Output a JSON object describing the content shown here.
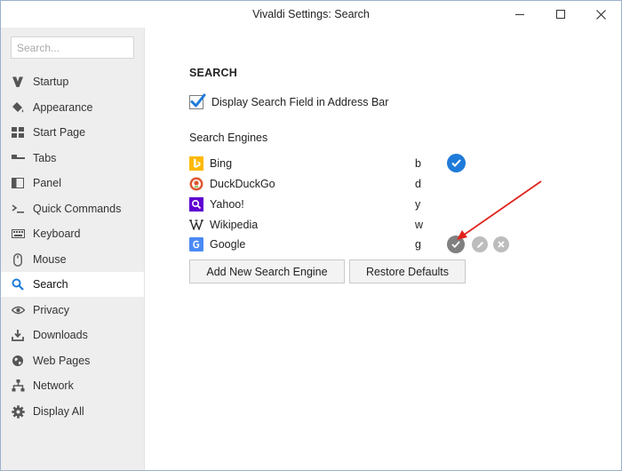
{
  "window": {
    "title": "Vivaldi Settings: Search"
  },
  "sidebar": {
    "search_placeholder": "Search...",
    "items": [
      {
        "label": "Startup",
        "icon": "vivaldi-v-icon",
        "active": false
      },
      {
        "label": "Appearance",
        "icon": "paint-bucket-icon",
        "active": false
      },
      {
        "label": "Start Page",
        "icon": "grid-icon",
        "active": false
      },
      {
        "label": "Tabs",
        "icon": "tabs-icon",
        "active": false
      },
      {
        "label": "Panel",
        "icon": "panel-icon",
        "active": false
      },
      {
        "label": "Quick Commands",
        "icon": "command-prompt-icon",
        "active": false
      },
      {
        "label": "Keyboard",
        "icon": "keyboard-icon",
        "active": false
      },
      {
        "label": "Mouse",
        "icon": "mouse-icon",
        "active": false
      },
      {
        "label": "Search",
        "icon": "magnifier-icon",
        "active": true
      },
      {
        "label": "Privacy",
        "icon": "eye-icon",
        "active": false
      },
      {
        "label": "Downloads",
        "icon": "download-icon",
        "active": false
      },
      {
        "label": "Web Pages",
        "icon": "globe-icon",
        "active": false
      },
      {
        "label": "Network",
        "icon": "network-icon",
        "active": false
      },
      {
        "label": "Display All",
        "icon": "gear-icon",
        "active": false
      }
    ]
  },
  "main": {
    "section_title": "SEARCH",
    "display_search_field": {
      "label": "Display Search Field in Address Bar",
      "checked": true
    },
    "engines_heading": "Search Engines",
    "engines": [
      {
        "name": "Bing",
        "key": "b",
        "logo": "bing-logo-icon",
        "is_default": true
      },
      {
        "name": "DuckDuckGo",
        "key": "d",
        "logo": "duckduckgo-logo-icon",
        "is_default": false
      },
      {
        "name": "Yahoo!",
        "key": "y",
        "logo": "yahoo-logo-icon",
        "is_default": false
      },
      {
        "name": "Wikipedia",
        "key": "w",
        "logo": "wikipedia-logo-icon",
        "is_default": false
      },
      {
        "name": "Google",
        "key": "g",
        "logo": "google-logo-icon",
        "is_default": false,
        "hovered": true
      }
    ],
    "buttons": {
      "add": "Add New Search Engine",
      "restore": "Restore Defaults"
    }
  },
  "colors": {
    "accent": "#1e7bd9",
    "sidebar_bg": "#eeeeee",
    "annotation_arrow": "#e0231c"
  }
}
